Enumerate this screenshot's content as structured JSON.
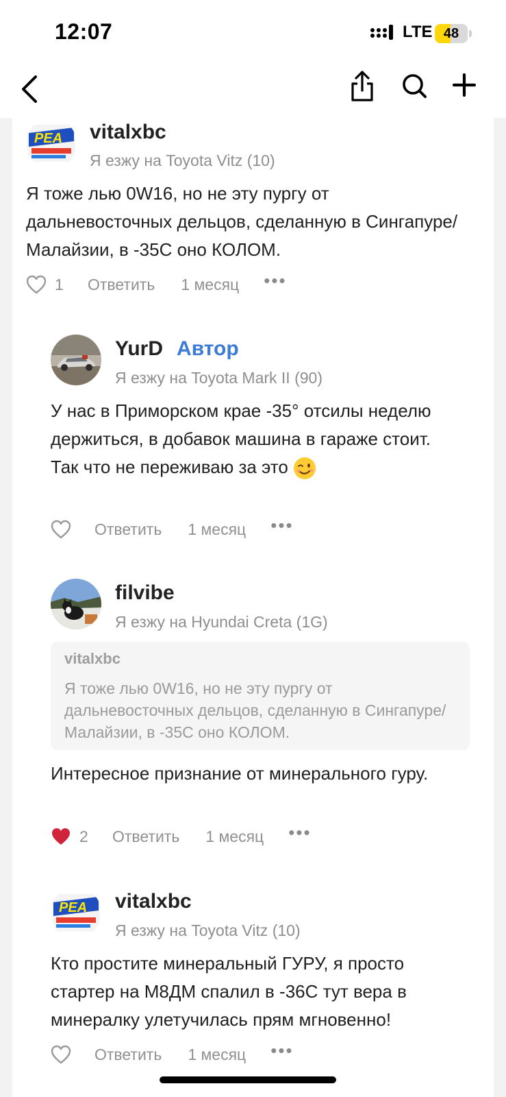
{
  "status_bar": {
    "time": "12:07",
    "network": "LTE",
    "battery": "48",
    "battery_level": 0.48
  },
  "nav": {
    "back_icon": "chevron-left-icon",
    "share_icon": "share-icon",
    "search_icon": "search-icon",
    "add_icon": "plus-icon"
  },
  "comments": [
    {
      "username": "vitalxbc",
      "is_author": false,
      "drives": "Я езжу на Toyota Vitz (10)",
      "text": "Я тоже лью 0W16, но не эту пургу от дальневосточных дельцов, сделанную в Сингапуре/Малайзии, в -35С оно КОЛОМ.",
      "likes": "1",
      "liked": false,
      "reply_label": "Ответить",
      "time": "1 месяц",
      "avatar_icon": "pea-logo-avatar"
    },
    {
      "username": "YurD",
      "is_author": true,
      "author_label": "Автор",
      "drives": "Я езжу на Toyota Mark II (90)",
      "text": "У нас в Приморском крае -35° отсилы неделю держиться, в добавок машина в гараже стоит. Так что не переживаю за это",
      "emoji": "winking-face-emoji",
      "likes": "",
      "liked": false,
      "reply_label": "Ответить",
      "time": "1 месяц",
      "avatar_icon": "car-photo-avatar"
    },
    {
      "username": "filvibe",
      "is_author": false,
      "drives": "Я езжу на Hyundai Creta (1G)",
      "quote": {
        "username": "vitalxbc",
        "text": "Я тоже лью 0W16, но не эту пургу от дальневосточных дельцов, сделанную в Сингапуре/Малайзии, в -35С оно КОЛОМ."
      },
      "text": "Интересное признание от минерального гуру.",
      "likes": "2",
      "liked": true,
      "reply_label": "Ответить",
      "time": "1 месяц",
      "avatar_icon": "cat-photo-avatar"
    },
    {
      "username": "vitalxbc",
      "is_author": false,
      "drives": "Я езжу на Toyota Vitz (10)",
      "text": "Кто простите минеральный ГУРУ, я просто стартер на М8ДМ спалил в -36С тут вера в минералку улетучилась прям мгновенно!",
      "likes": "",
      "liked": false,
      "reply_label": "Ответить",
      "time": "1 месяц",
      "avatar_icon": "pea-logo-avatar"
    }
  ],
  "colors": {
    "author_badge": "#3d7bd6",
    "liked_heart": "#d0243a",
    "muted_text": "#909090",
    "battery_fill": "#ffd60a"
  }
}
